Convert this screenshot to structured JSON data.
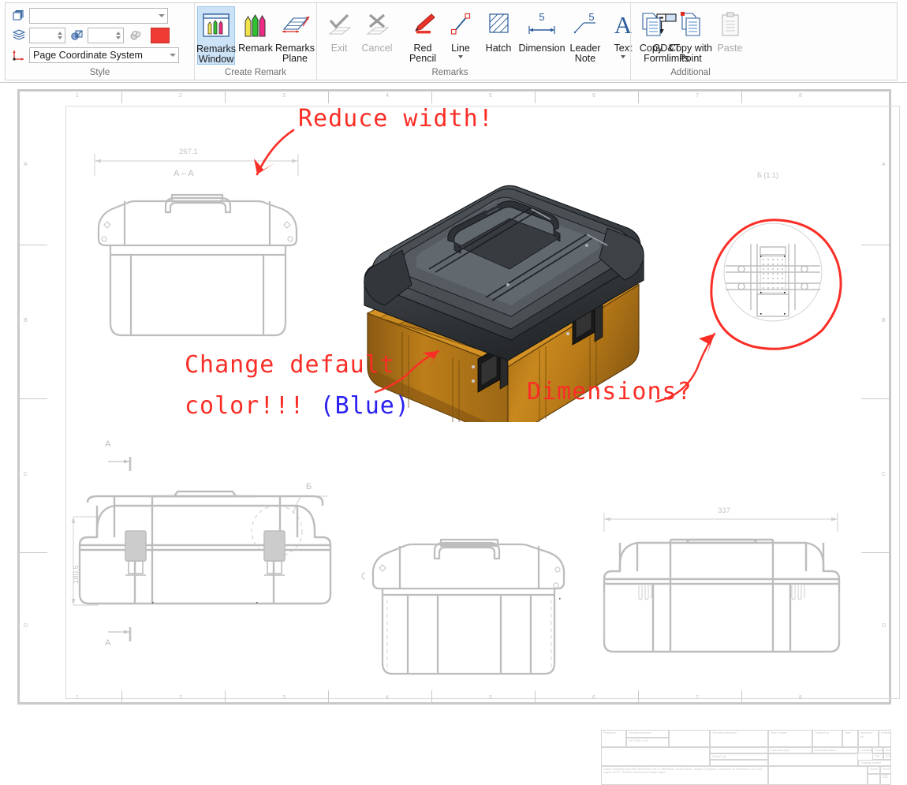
{
  "app": {
    "ribbon_tab": "Remarks"
  },
  "ribbon": {
    "groups": [
      {
        "title": "Style"
      },
      {
        "title": "Create Remark"
      },
      {
        "title": "Remarks"
      },
      {
        "title": "Additional"
      }
    ],
    "style": {
      "title": "Style",
      "layer_value": "",
      "thickness_value": "",
      "scale_value": "",
      "coordinate_system_value": "Page Coordinate System",
      "color_hex": "#f03a34",
      "icons": {
        "style_sheets": "style-sheets-icon",
        "layers": "layers-icon",
        "line_style": "line-style-icon",
        "sphere": "sphere-icon",
        "coordinate_system": "coordinate-system-icon"
      }
    },
    "create_remark": {
      "title": "Create Remark",
      "buttons": [
        {
          "label": "Remarks\nWindow",
          "line1": "Remarks",
          "line2": "Window",
          "icon": "remarks-window-icon",
          "selected": true,
          "enabled": true
        },
        {
          "label": "Remark",
          "line1": "Remark",
          "line2": "",
          "icon": "remark-icon",
          "selected": false,
          "enabled": true
        },
        {
          "label": "Remarks\nPlane",
          "line1": "Remarks",
          "line2": "Plane",
          "icon": "remarks-plane-icon",
          "selected": false,
          "enabled": true
        }
      ]
    },
    "remarks": {
      "title": "Remarks",
      "buttons": [
        {
          "line1": "Exit",
          "line2": "",
          "icon": "exit-check-icon",
          "enabled": false,
          "dropdown": false
        },
        {
          "line1": "Cancel",
          "line2": "",
          "icon": "cancel-cross-icon",
          "enabled": false,
          "dropdown": false
        },
        {
          "line1": "Red",
          "line2": "Pencil",
          "icon": "red-pencil-icon",
          "enabled": true,
          "dropdown": false
        },
        {
          "line1": "Line",
          "line2": "",
          "icon": "line-icon",
          "enabled": true,
          "dropdown": true
        },
        {
          "line1": "Hatch",
          "line2": "",
          "icon": "hatch-icon",
          "enabled": true,
          "dropdown": false
        },
        {
          "line1": "Dimension",
          "line2": "",
          "icon": "dimension-icon",
          "enabled": true,
          "dropdown": false
        },
        {
          "line1": "Leader",
          "line2": "Note",
          "icon": "leader-note-icon",
          "enabled": true,
          "dropdown": false
        },
        {
          "line1": "Text",
          "line2": "",
          "icon": "text-icon",
          "enabled": true,
          "dropdown": true
        },
        {
          "line1": "GD&T",
          "line2": "Formlimits",
          "icon": "gdt-formlimits-icon",
          "enabled": true,
          "dropdown": true
        }
      ]
    },
    "additional": {
      "title": "Additional",
      "buttons": [
        {
          "line1": "Copy",
          "line2": "",
          "icon": "copy-icon",
          "enabled": true
        },
        {
          "line1": "Copy with",
          "line2": "Point",
          "icon": "copy-with-point-icon",
          "enabled": true
        },
        {
          "line1": "Paste",
          "line2": "",
          "icon": "paste-icon",
          "enabled": false
        }
      ]
    }
  },
  "drawing": {
    "zones_top": [
      "1",
      "2",
      "3",
      "4",
      "5",
      "6",
      "7",
      "8"
    ],
    "zones_bottom": [
      "1",
      "2",
      "3",
      "4",
      "5",
      "6",
      "7",
      "8"
    ],
    "zones_left": [
      "A",
      "B",
      "C",
      "D"
    ],
    "zones_right": [
      "A",
      "B",
      "C",
      "D"
    ],
    "views": {
      "section_aa": {
        "label": "A – A",
        "dimension_width": "267.1"
      },
      "detail_b": {
        "label": "Б (1:1)"
      },
      "front": {
        "dimension_height": "180.5",
        "section_mark_top": "A",
        "section_mark_bottom": "A",
        "detail_callout": "Б"
      },
      "side": {
        "dimension_width": "337"
      }
    },
    "titleblock": {
      "projection": "Projection",
      "general_tolerance": "General tolerance",
      "tolerance_value": "ISO 2768-1 mK",
      "technical_reference": "Technical reference",
      "short_name": "Short i Name",
      "created_by": "Created by",
      "date": "Date",
      "approved_by": "Approved by",
      "reference": "Reference",
      "document_type": "Document type",
      "document_status": "Document status",
      "checked": "Checked",
      "format": "Format",
      "scale": "Scale",
      "format_value": "A3",
      "scale_value": "1:2",
      "weight_kg": "Weight, kg",
      "drawing_number": "Drawing number",
      "series": "Series",
      "sheet": "Sheet",
      "sheet_value": "1/1",
      "note_line1": "Unless otherwise specified dimensions are in millimetres, surface finish,",
      "note_line2": "angles in degrees, tolerances on dimensions ±0.5 and angles ±0°30'.",
      "note_line3": "Remove all burrs and sharp edges."
    }
  },
  "annotations": [
    {
      "id": "a1",
      "text": "Reduce width!",
      "color": "#fa2e26",
      "kind": "red-pencil-text"
    },
    {
      "id": "a2",
      "text_main": "Change default",
      "text_second_a": "color!!! ",
      "text_second_b": "(Blue)",
      "color": "#fa2e26",
      "accent_color": "#2a20f0",
      "kind": "red-pencil-text"
    },
    {
      "id": "a3",
      "text": "Dimensions?",
      "color": "#fa2e26",
      "kind": "red-pencil-text"
    }
  ],
  "model": {
    "name": "rugged-case-3d-model",
    "lid_color": "#3a3d40",
    "body_color": "#b8791a",
    "latch_color": "#1c1c1c"
  }
}
